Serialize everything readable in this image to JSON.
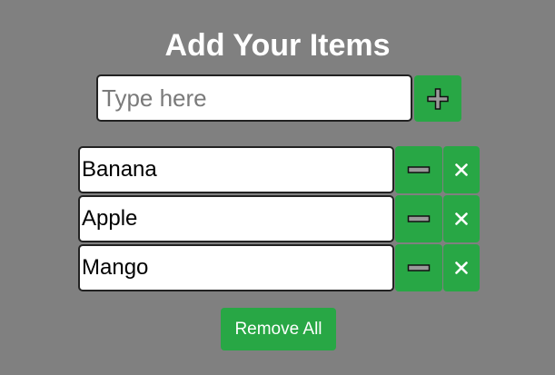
{
  "header": {
    "title": "Add Your Items"
  },
  "add_form": {
    "input_value": "",
    "placeholder": "Type here",
    "add_icon": "plus-icon"
  },
  "items": [
    {
      "value": "Banana"
    },
    {
      "value": "Apple"
    },
    {
      "value": "Mango"
    }
  ],
  "item_actions": {
    "edit_icon": "minus-icon",
    "delete_icon": "close-icon"
  },
  "footer": {
    "remove_all_label": "Remove All"
  },
  "colors": {
    "background": "#808080",
    "accent": "#28a745",
    "text_on_accent": "#ffffff"
  }
}
